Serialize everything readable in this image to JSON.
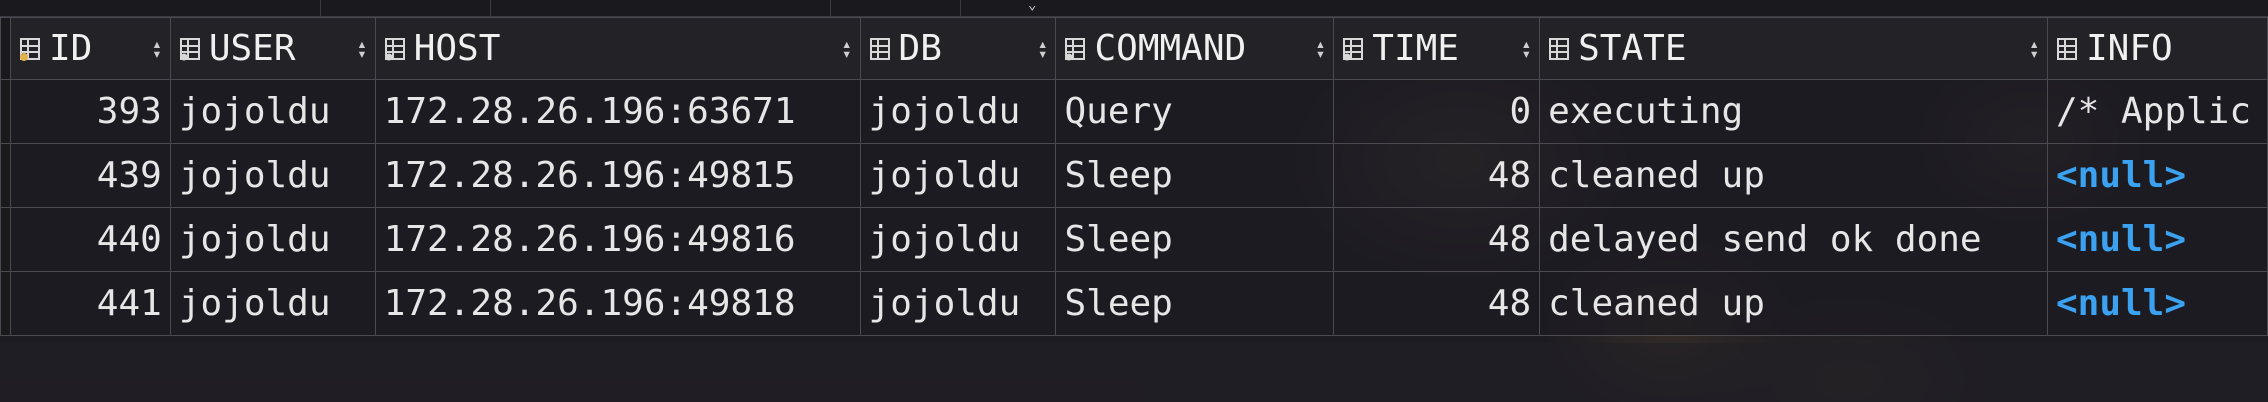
{
  "columns": [
    {
      "key": "id",
      "label": "ID"
    },
    {
      "key": "user",
      "label": "USER"
    },
    {
      "key": "host",
      "label": "HOST"
    },
    {
      "key": "db",
      "label": "DB"
    },
    {
      "key": "command",
      "label": "COMMAND"
    },
    {
      "key": "time",
      "label": "TIME"
    },
    {
      "key": "state",
      "label": "STATE"
    },
    {
      "key": "info",
      "label": "INFO"
    }
  ],
  "rows": [
    {
      "id": "393",
      "user": "jojoldu",
      "host": "172.28.26.196:63671",
      "db": "jojoldu",
      "command": "Query",
      "time": "0",
      "state": "executing",
      "info": "/* Applic"
    },
    {
      "id": "439",
      "user": "jojoldu",
      "host": "172.28.26.196:49815",
      "db": "jojoldu",
      "command": "Sleep",
      "time": "48",
      "state": "cleaned up",
      "info": "<null>"
    },
    {
      "id": "440",
      "user": "jojoldu",
      "host": "172.28.26.196:49816",
      "db": "jojoldu",
      "command": "Sleep",
      "time": "48",
      "state": "delayed send ok done",
      "info": "<null>"
    },
    {
      "id": "441",
      "user": "jojoldu",
      "host": "172.28.26.196:49818",
      "db": "jojoldu",
      "command": "Sleep",
      "time": "48",
      "state": "cleaned up",
      "info": "<null>"
    }
  ],
  "colors": {
    "null_value": "#3aa2f0",
    "background": "#1d1c22",
    "grid": "#4a4a50"
  }
}
